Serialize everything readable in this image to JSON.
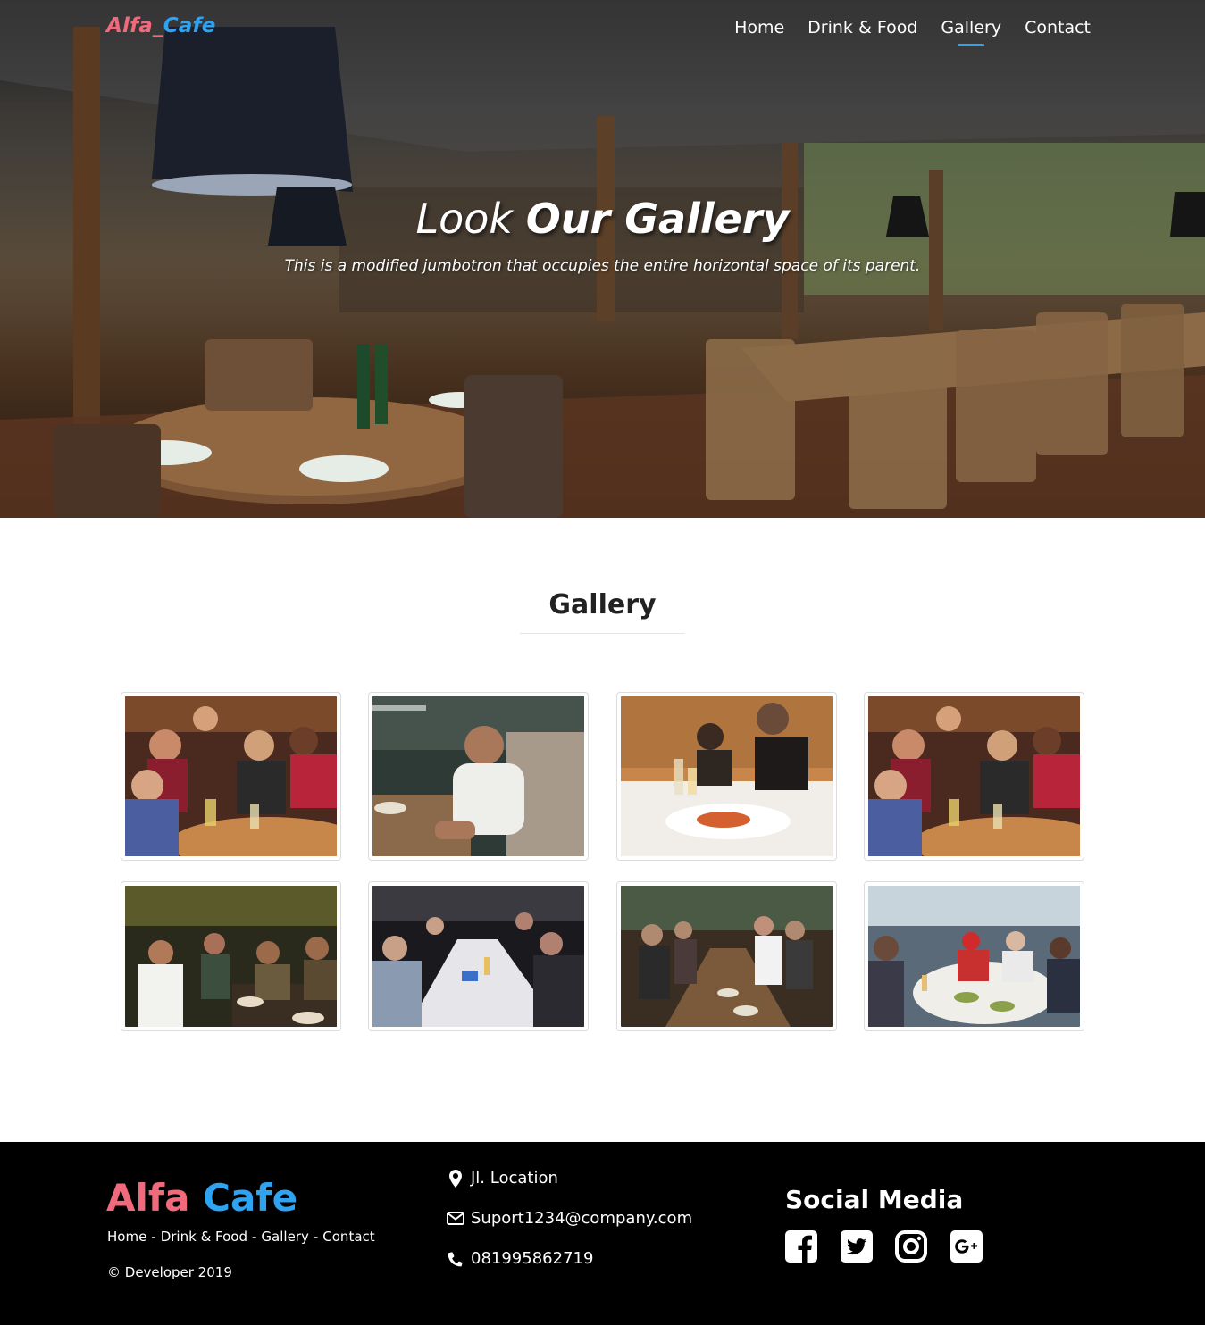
{
  "nav": {
    "brand_part1": "Alfa_",
    "brand_part2": "Cafe",
    "links": [
      "Home",
      "Drink & Food",
      "Gallery",
      "Contact"
    ],
    "active": "Gallery"
  },
  "hero": {
    "title_light": "Look",
    "title_bold": "Our Gallery",
    "subtitle": "This is a modified jumbotron that occupies the entire horizontal space of its parent."
  },
  "gallery": {
    "title": "Gallery"
  },
  "footer": {
    "brand_part1": "Alfa",
    "brand_part2": "Cafe",
    "links": [
      "Home",
      "Drink & Food",
      "Gallery",
      "Contact"
    ],
    "copyright": "© Developer 2019",
    "location": "Jl. Location",
    "email": "Suport1234@company.com",
    "phone": "081995862719",
    "social_title": "Social Media",
    "social_icons": [
      "facebook-icon",
      "twitter-icon",
      "instagram-icon",
      "google-plus-icon"
    ]
  },
  "colors": {
    "brand_pink": "#f06a7c",
    "brand_blue": "#2ea3f2",
    "footer_bg": "#000000"
  }
}
